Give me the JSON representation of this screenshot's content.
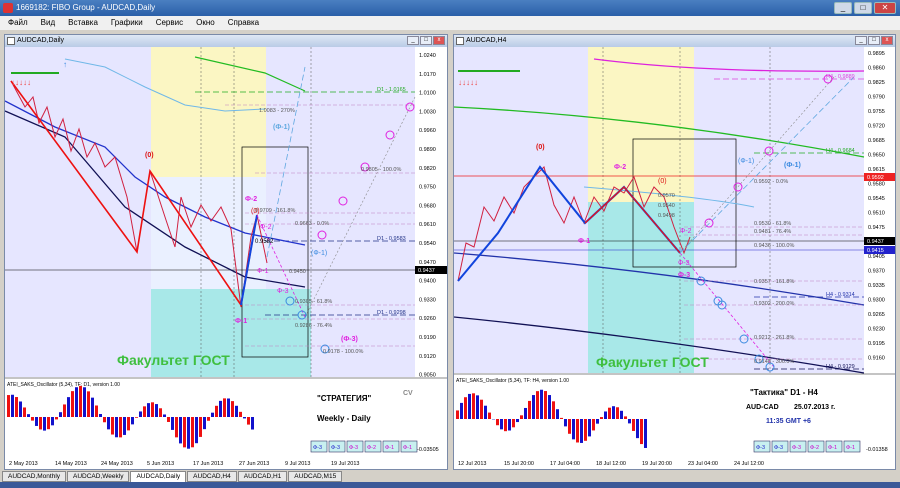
{
  "window": {
    "title": "1669182: FIBO Group - AUDCAD,Daily",
    "min": "_",
    "max": "□",
    "close": "✕"
  },
  "menu": [
    "Файл",
    "Вид",
    "Вставка",
    "Графики",
    "Сервис",
    "Окно",
    "Справка"
  ],
  "left": {
    "title": "AUDCAD,Daily",
    "prices": [
      "1.0240",
      "1.0170",
      "1.0100",
      "1.0030",
      "0.9960",
      "0.9890",
      "0.9820",
      "0.9750",
      "0.9680",
      "0.9610",
      "0.9540",
      "0.9470",
      "0.9400",
      "0.9330",
      "0.9260",
      "0.9190",
      "0.9120",
      "0.9050"
    ],
    "last_price": "0.9437",
    "levels": [
      "D1 - 1.0165",
      "1.0083 - 270%",
      "D1 - 0.9583",
      "D1 - 0.9298",
      "0.9582",
      "0.9450"
    ],
    "fib_labels": [
      "0.9805 - 100.0%",
      "0.9709 - 161.8%",
      "0.9663 - 0.0%",
      "0.9305 - 61.8%",
      "0.9286 - 76.4%",
      "0.9178 - 100.0%"
    ],
    "wave_labels": [
      "(0)",
      "Ф-2",
      "(Ф-1)",
      "Ф-2",
      "Ф-1",
      "Ф-3",
      "Ф-1",
      "(Ф-1)",
      "(0)",
      "(Ф-3)"
    ],
    "watermark": "Факультет ГОСТ",
    "osc_title": "ATEI_SAKS_Oscillator (5,34), TF: D1, version 1.00",
    "osc_scale": [
      "",
      "-0.03505"
    ],
    "strategy": "\"СТРАТЕГИЯ\"",
    "strategy_sub": "Weekly - Daily",
    "cv": "CV",
    "buttons": [
      "Ф-3",
      "Ф-3",
      "Ф-3",
      "Ф-2",
      "Ф-1",
      "Ф-1"
    ],
    "dates": [
      "2 May 2013",
      "14 May 2013",
      "24 May 2013",
      "5 Jun 2013",
      "17 Jun 2013",
      "27 Jun 2013",
      "9 Jul 2013",
      "19 Jul 2013"
    ]
  },
  "right": {
    "title": "AUDCAD,H4",
    "prices": [
      "0.9895",
      "0.9860",
      "0.9825",
      "0.9790",
      "0.9755",
      "0.9720",
      "0.9685",
      "0.9650",
      "0.9615",
      "0.9580",
      "0.9545",
      "0.9510",
      "0.9475",
      "0.9440",
      "0.9405",
      "0.9370",
      "0.9335",
      "0.9300",
      "0.9265",
      "0.9230",
      "0.9195",
      "0.9160"
    ],
    "red_price": "0.9592",
    "last_price": "0.9437",
    "blue_price": "0.9415",
    "levels": [
      "H4 - 0.9889",
      "H4 - 0.9684",
      "H4 - 0.9314",
      "H4 - 0.9129",
      "0.9570",
      "0.9540",
      "0.9498"
    ],
    "fib_labels": [
      "0.9592 - 0.0%",
      "0.9530 - 61.8%",
      "0.9481 - 76.4%",
      "0.9436 - 100.0%",
      "0.9357 - 161.8%",
      "0.9302 - 200.0%",
      "0.9212 - 261.8%",
      "0.9148 - 300.0%"
    ],
    "wave_labels": [
      "(0)",
      "Ф-2",
      "(0)",
      "Ф-1",
      "Ф-2",
      "Ф-3",
      "(Ф-1)",
      "(Ф-1)",
      "Ф-3"
    ],
    "watermark": "Факультет ГОСТ",
    "osc_title": "ATEI_SAKS_Oscillator (5,34), TF: H4, version 1.00",
    "tactic": "\"Тактика\"  D1 - H4",
    "pair": "AUD-CAD",
    "date": "25.07.2013  г.",
    "time": "11:35  GMT +6",
    "buttons": [
      "Ф-3",
      "Ф-3",
      "Ф-3",
      "Ф-2",
      "Ф-1",
      "Ф-1"
    ],
    "dates": [
      "12 Jul 2013",
      "15 Jul 20:00",
      "17 Jul 04:00",
      "18 Jul 12:00",
      "19 Jul 20:00",
      "23 Jul 04:00",
      "24 Jul 12:00"
    ],
    "osc_scale": [
      "",
      "-0.01358"
    ]
  },
  "tabs": [
    "AUDCAD,Monthly",
    "AUDCAD,Weekly",
    "AUDCAD,Daily",
    "AUDCAD,H4",
    "AUDCAD,H1",
    "AUDCAD,M15"
  ],
  "colors": {
    "bg": "#e6e6ff",
    "fibo_yellow": "#fbf6c3",
    "fibo_cyan": "#a8e8e8",
    "watermark": "#3fbf3f",
    "magenta": "#e020e0"
  }
}
